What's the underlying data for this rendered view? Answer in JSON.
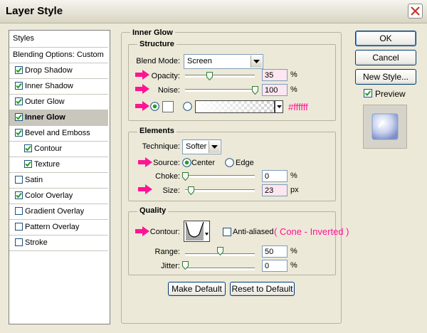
{
  "window": {
    "title": "Layer Style"
  },
  "styles_list": {
    "header": "Styles",
    "blending": "Blending Options: Custom",
    "items": [
      {
        "label": "Drop Shadow",
        "checked": true
      },
      {
        "label": "Inner Shadow",
        "checked": true
      },
      {
        "label": "Outer Glow",
        "checked": true
      },
      {
        "label": "Inner Glow",
        "checked": true,
        "selected": true
      },
      {
        "label": "Bevel and Emboss",
        "checked": true
      },
      {
        "label": "Contour",
        "checked": true,
        "indent": true
      },
      {
        "label": "Texture",
        "checked": true,
        "indent": true
      },
      {
        "label": "Satin",
        "checked": false
      },
      {
        "label": "Color Overlay",
        "checked": true
      },
      {
        "label": "Gradient Overlay",
        "checked": false
      },
      {
        "label": "Pattern Overlay",
        "checked": false
      },
      {
        "label": "Stroke",
        "checked": false
      }
    ]
  },
  "inner_glow": {
    "title": "Inner Glow",
    "structure": {
      "title": "Structure",
      "blend_mode_label": "Blend Mode:",
      "blend_mode_value": "Screen",
      "opacity_label": "Opacity:",
      "opacity_value": "35",
      "opacity_percent": 35,
      "noise_label": "Noise:",
      "noise_value": "100",
      "noise_percent": 100,
      "unit_percent": "%",
      "color_annotation": "#ffffff",
      "color": "#ffffff"
    },
    "elements": {
      "title": "Elements",
      "technique_label": "Technique:",
      "technique_value": "Softer",
      "source_label": "Source:",
      "source_center": "Center",
      "source_edge": "Edge",
      "choke_label": "Choke:",
      "choke_value": "0",
      "choke_percent": 0,
      "size_label": "Size:",
      "size_value": "23",
      "size_fraction": 0.09,
      "unit_percent": "%",
      "unit_px": "px"
    },
    "quality": {
      "title": "Quality",
      "contour_label": "Contour:",
      "anti_aliased_label": "Anti-aliased",
      "anti_aliased": false,
      "contour_annotation": "( Cone - Inverted )",
      "range_label": "Range:",
      "range_value": "50",
      "range_percent": 50,
      "jitter_label": "Jitter:",
      "jitter_value": "0",
      "jitter_percent": 0,
      "unit_percent": "%"
    },
    "make_default": "Make Default",
    "reset_default": "Reset to Default"
  },
  "buttons": {
    "ok": "OK",
    "cancel": "Cancel",
    "new_style": "New Style...",
    "preview_label": "Preview",
    "preview_checked": true
  },
  "colors": {
    "annotation": "#ff1493",
    "selection": "#c9c7bd",
    "dialog_bg": "#ece9d8"
  }
}
